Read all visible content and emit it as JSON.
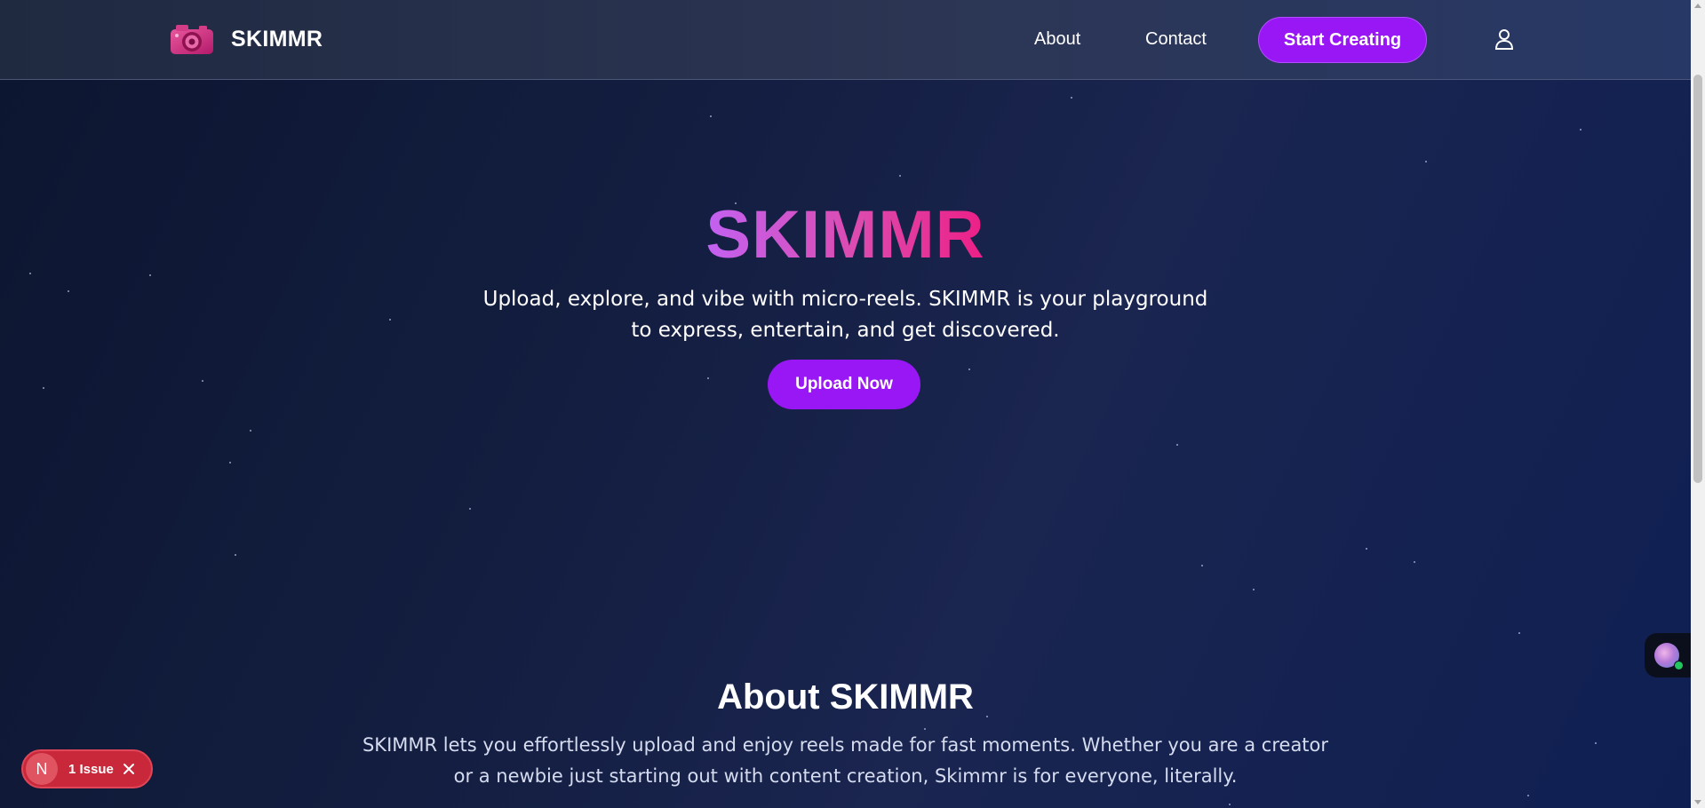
{
  "nav": {
    "logo_text": "SKIMMR",
    "about_label": "About",
    "contact_label": "Contact",
    "cta_label": "Start Creating"
  },
  "hero": {
    "title": "SKIMMR",
    "subtitle": "Upload, explore, and vibe with micro-reels. SKIMMR is your playground to express, entertain, and get discovered.",
    "upload_label": "Upload Now"
  },
  "about": {
    "title": "About SKIMMR",
    "text": "SKIMMR lets you effortlessly upload and enjoy reels made for fast moments. Whether you are a creator or a newbie just starting out with content creation, Skimmr is for everyone, literally."
  },
  "issues": {
    "initial": "N",
    "label": "1 Issue"
  },
  "colors": {
    "accent": "#9a17f5",
    "title_gradient_start": "#c262f2",
    "title_gradient_end": "#ec1f86",
    "issue_badge": "#c8283a",
    "online_dot": "#22c55e"
  },
  "icons": {
    "logo": "camera-logo-icon",
    "user": "user-icon",
    "close": "close-icon",
    "chat": "chat-avatar-icon"
  }
}
